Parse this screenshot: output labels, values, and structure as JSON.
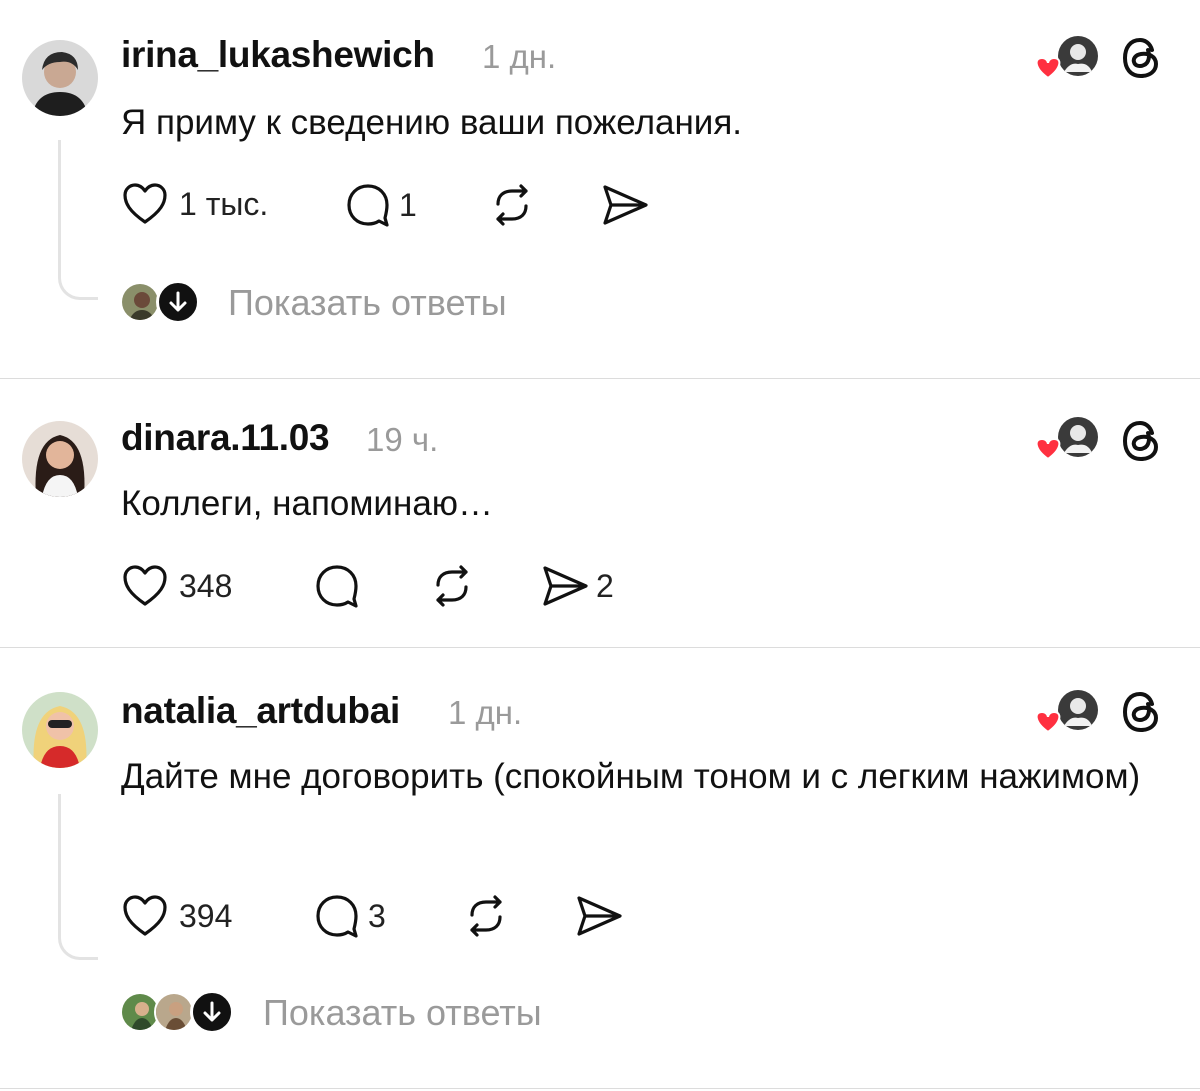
{
  "posts": [
    {
      "username": "irina_lukashewich",
      "time": "1 дн.",
      "text": "Я приму к сведению ваши пожелания.",
      "likes": "1 тыс.",
      "replies": "1",
      "reposts": "",
      "shares": "",
      "show_replies": "Показать ответы"
    },
    {
      "username": "dinara.11.03",
      "time": "19 ч.",
      "text": "Коллеги, напоминаю…",
      "likes": "348",
      "replies": "",
      "reposts": "",
      "shares": "2"
    },
    {
      "username": "natalia_artdubai",
      "time": "1 дн.",
      "text": "Дайте мне договорить (спокойным тоном и с легким нажимом)",
      "likes": "394",
      "replies": "3",
      "reposts": "",
      "shares": "",
      "show_replies": "Показать ответы"
    }
  ],
  "icons": {
    "like": "heart-outline-icon",
    "reply": "comment-bubble-icon",
    "repost": "repost-arrows-icon",
    "share": "send-icon",
    "brand": "threads-logo-icon",
    "liked_by": "liked-by-author-badge",
    "expand": "arrow-down-icon"
  },
  "colors": {
    "heart_red": "#ff3040",
    "muted_text": "#9a9a9a",
    "divider": "#dcdcdc"
  }
}
